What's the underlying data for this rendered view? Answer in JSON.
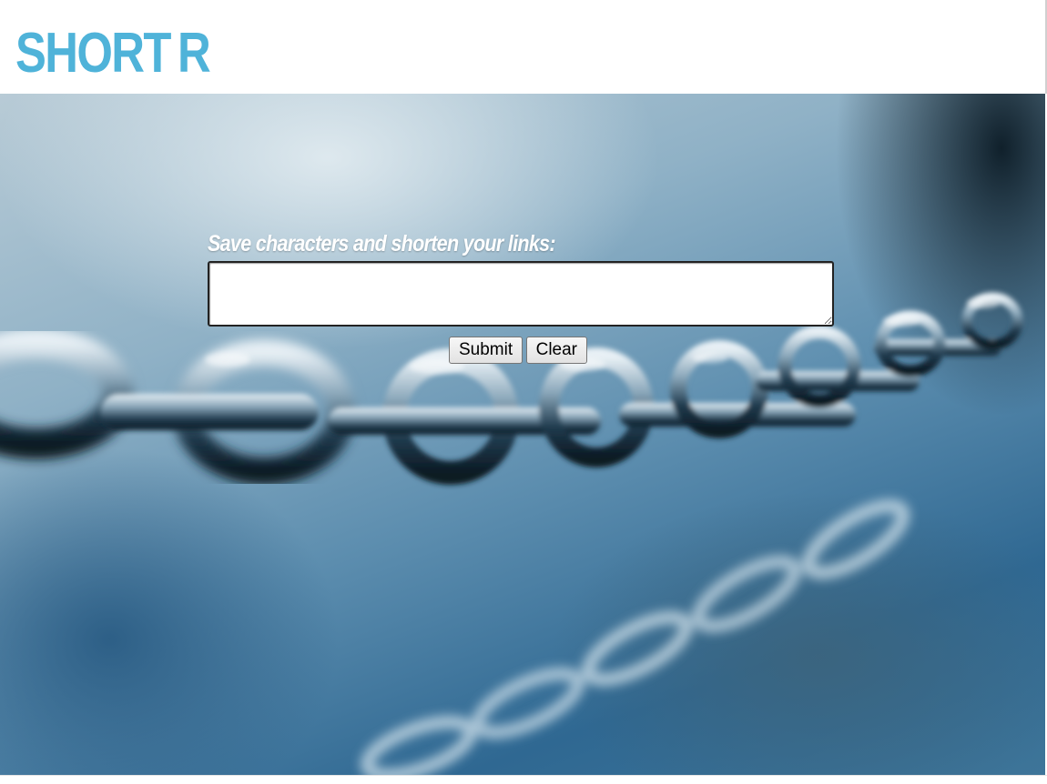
{
  "header": {
    "logo": "SHORTR",
    "logo_color": "#4fb3d9"
  },
  "form": {
    "label": "Save characters and shorten your links:",
    "input_value": "",
    "submit_label": "Submit",
    "clear_label": "Clear"
  }
}
